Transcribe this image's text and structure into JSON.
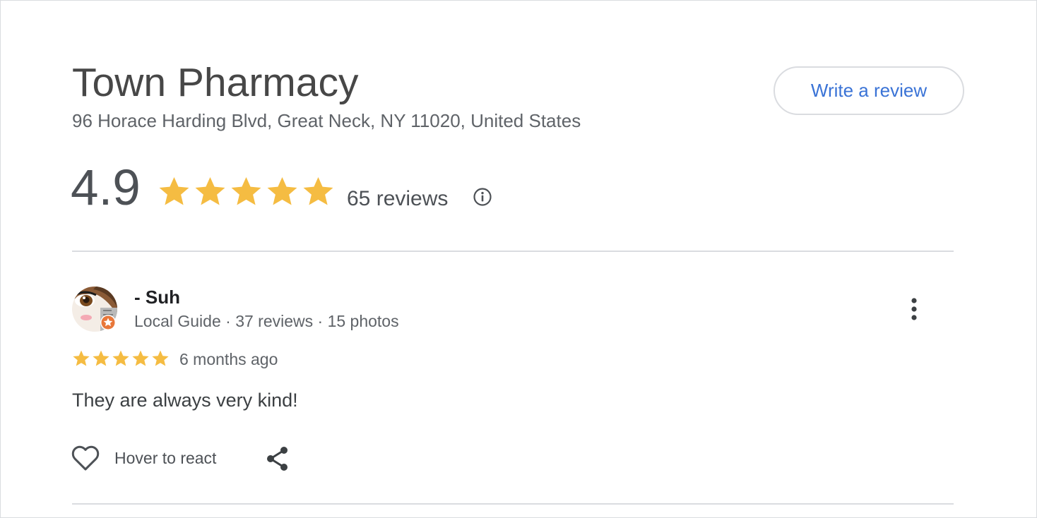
{
  "place": {
    "name": "Town Pharmacy",
    "address": "96 Horace Harding Blvd, Great Neck, NY 11020, United States"
  },
  "actions": {
    "write_review_label": "Write a review"
  },
  "summary": {
    "rating": "4.9",
    "stars_filled": 5,
    "stars_total": 5,
    "review_count_label": "65 reviews"
  },
  "review": {
    "author": "- Suh",
    "author_meta": "Local Guide · 37 reviews · 15 photos",
    "stars_filled": 5,
    "date": "6 months ago",
    "text": "They are always very kind!",
    "react_label": "Hover to react"
  },
  "colors": {
    "star": "#f5bc42",
    "link": "#3a73d6",
    "border": "#dadce0",
    "local_guide_badge": "#e8773a"
  },
  "icons": {
    "info": "info-icon",
    "more": "more-vert-icon",
    "heart": "heart-outline-icon",
    "share": "share-icon"
  }
}
